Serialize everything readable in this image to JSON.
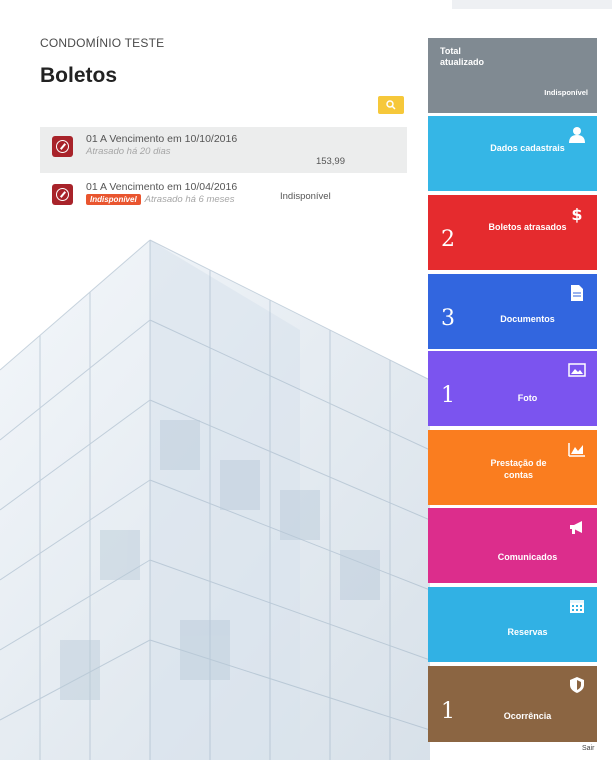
{
  "header": {
    "condominio": "CONDOMÍNIO TESTE",
    "title": "Boletos"
  },
  "boletos": [
    {
      "vencimento": "01 A Vencimento em 10/10/2016",
      "atraso": "Atrasado há 20 dias",
      "status": "",
      "valor": "153,99"
    },
    {
      "vencimento": "01 A Vencimento em 10/04/2016",
      "atraso": "Atrasado há 6 meses",
      "status": "Indisponível",
      "valor": "Indisponível"
    }
  ],
  "sidebar": {
    "total": {
      "title": "Total atualizado",
      "value": "Indisponível"
    },
    "tiles": [
      {
        "label": "Dados cadastrais",
        "count": "",
        "icon": "user-icon",
        "color": "#35b6e6"
      },
      {
        "label": "Boletos atrasados",
        "count": "2",
        "icon": "dollar-icon",
        "color": "#e52b2e"
      },
      {
        "label": "Documentos",
        "count": "3",
        "icon": "document-icon",
        "color": "#3266df"
      },
      {
        "label": "Foto",
        "count": "1",
        "icon": "image-icon",
        "color": "#7b54ef"
      },
      {
        "label": "Prestação de contas",
        "count": "",
        "icon": "chart-icon",
        "color": "#fa7d1f"
      },
      {
        "label": "Comunicados",
        "count": "",
        "icon": "megaphone-icon",
        "color": "#dc2d8c"
      },
      {
        "label": "Reservas",
        "count": "",
        "icon": "calendar-icon",
        "color": "#31b1e4"
      },
      {
        "label": "Ocorrência",
        "count": "1",
        "icon": "shield-icon",
        "color": "#8b6542"
      }
    ]
  },
  "footer": {
    "logout": "Sair"
  }
}
